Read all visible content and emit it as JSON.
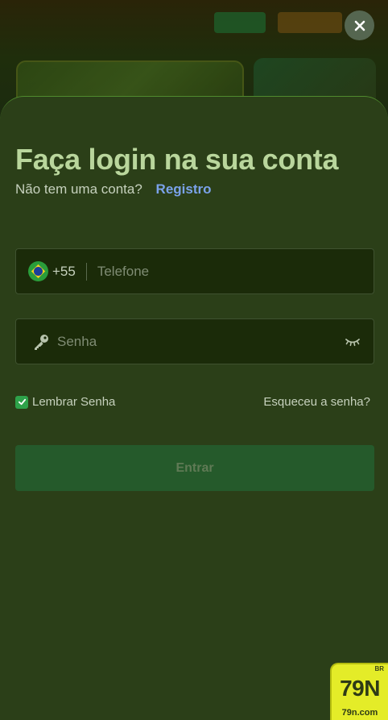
{
  "modal": {
    "title": "Faça login na sua conta",
    "no_account_text": "Não tem uma conta?",
    "register_link": "Registro",
    "phone": {
      "dial_code": "+55",
      "placeholder": "Telefone",
      "flag_icon": "brazil-flag-icon"
    },
    "password": {
      "placeholder": "Senha",
      "leading_icon": "key-icon",
      "toggle_icon": "eye-closed-icon"
    },
    "remember_label": "Lembrar Senha",
    "remember_checked": true,
    "forgot_link": "Esqueceu a senha?",
    "submit_label": "Entrar",
    "close_icon": "close-icon"
  },
  "watermark": {
    "main": "79N",
    "sup": "BR",
    "sub": "79n.com"
  },
  "colors": {
    "sheet_bg": "#2b3f18",
    "title": "#b9d69c",
    "link": "#7aa2ea",
    "input_bg": "#1b2b09",
    "checkbox": "#2ea24a",
    "button_bg": "#255a2b",
    "button_text": "#5f7a55",
    "logo_bg": "#e4ec28"
  }
}
